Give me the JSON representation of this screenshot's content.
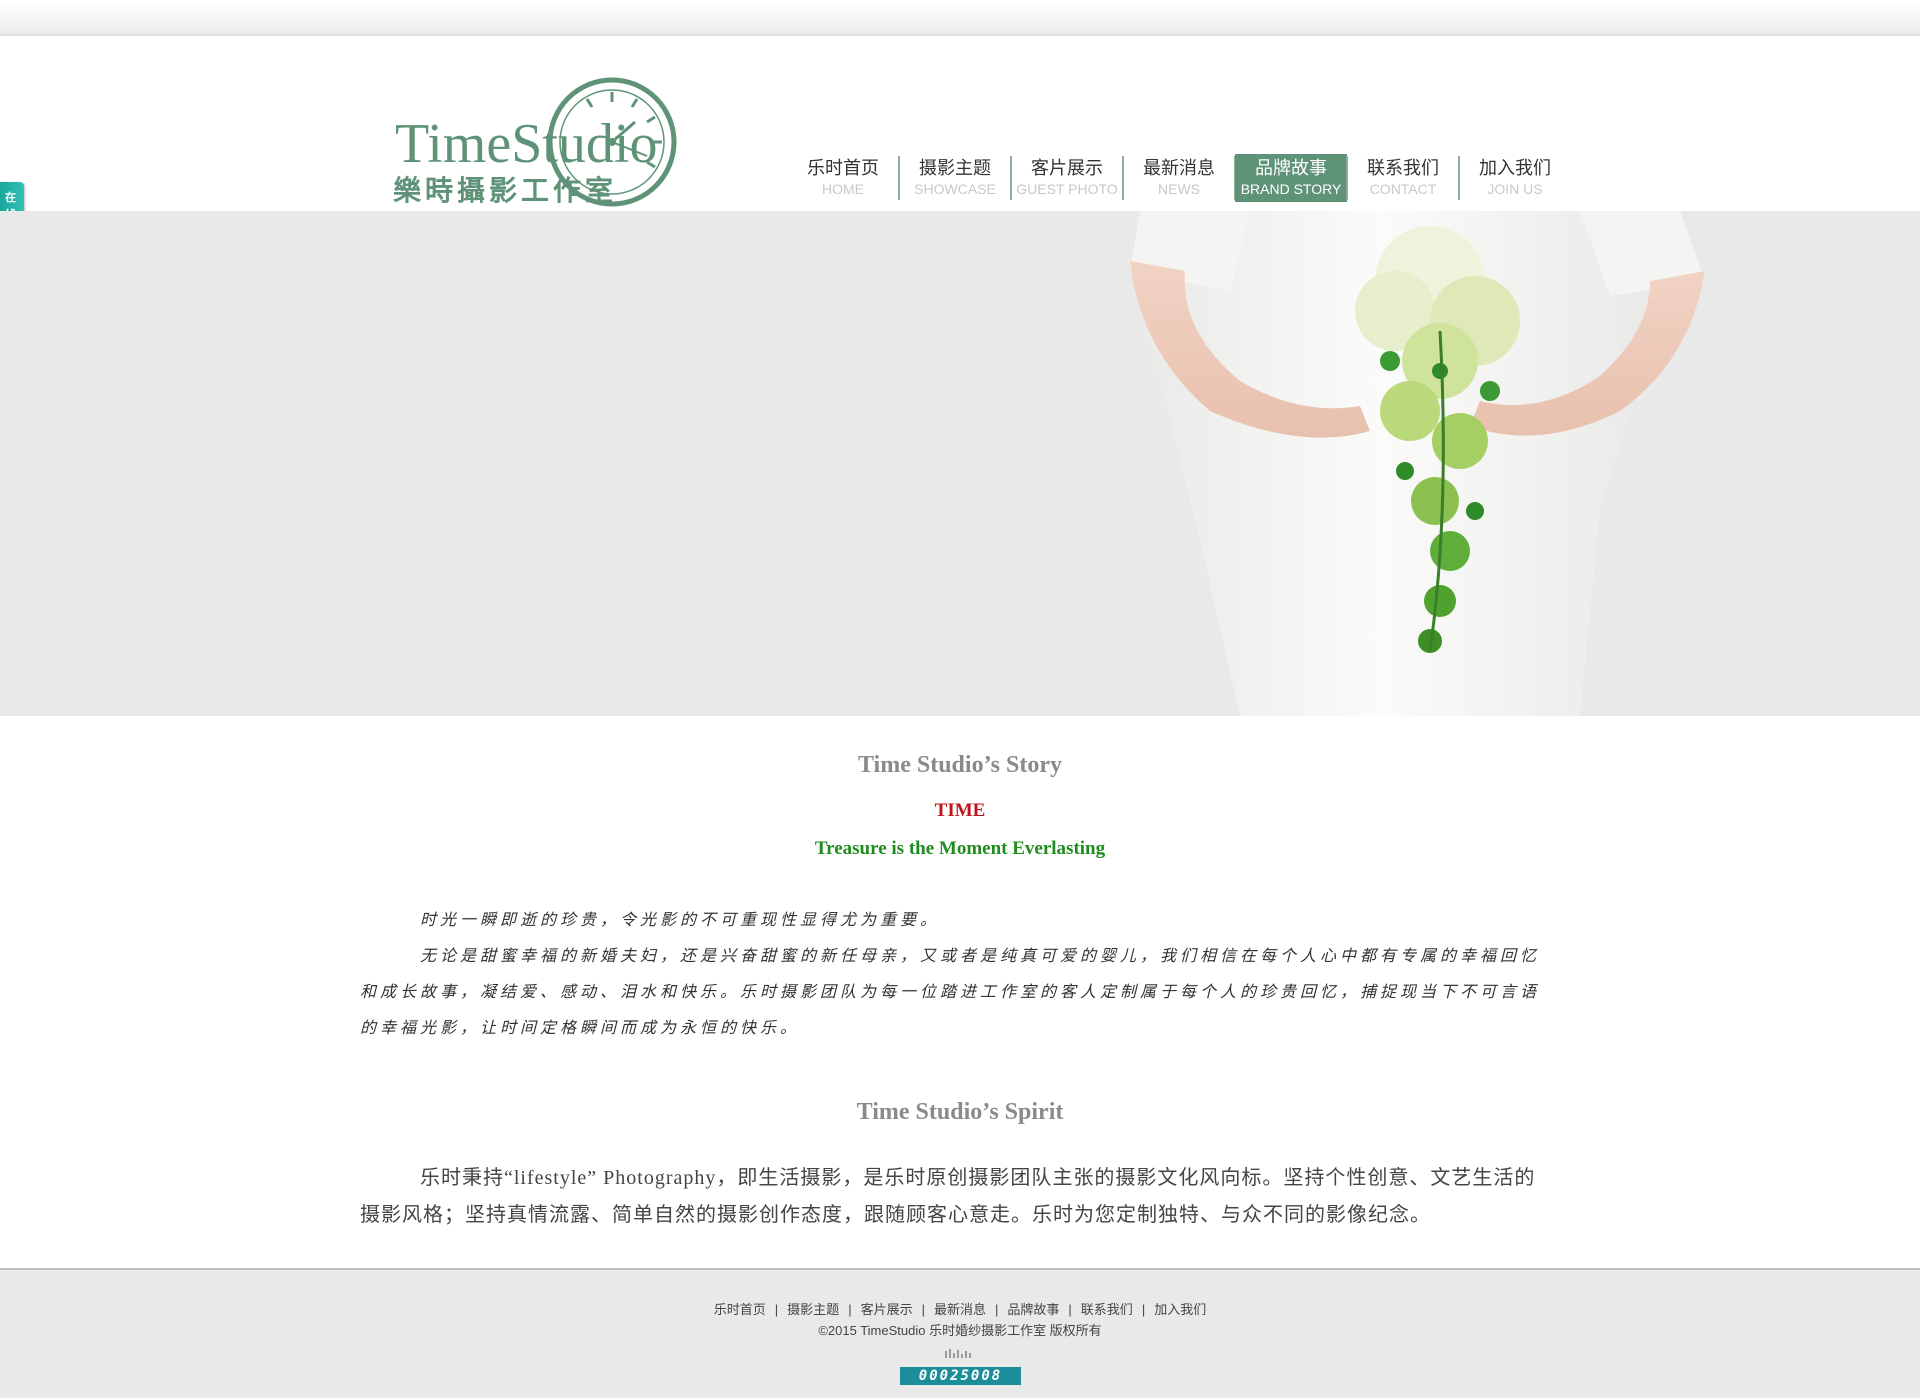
{
  "logo": {
    "name_en": "TimeStudio",
    "name_cn": "樂時攝影工作室"
  },
  "nav": {
    "items": [
      {
        "cn": "乐时首页",
        "en": "HOME"
      },
      {
        "cn": "摄影主题",
        "en": "SHOWCASE"
      },
      {
        "cn": "客片展示",
        "en": "GUEST PHOTO"
      },
      {
        "cn": "最新消息",
        "en": "NEWS"
      },
      {
        "cn": "品牌故事",
        "en": "BRAND STORY"
      },
      {
        "cn": "联系我们",
        "en": "CONTACT"
      },
      {
        "cn": "加入我们",
        "en": "JOIN US"
      }
    ],
    "active": "品牌故事"
  },
  "sidetab": {
    "label": "在线客服"
  },
  "content": {
    "story_title": "Time Studio’s Story",
    "time_label": "TIME",
    "tagline": "Treasure is the Moment Everlasting",
    "story_p1": "时光一瞬即逝的珍贵，令光影的不可重现性显得尤为重要。",
    "story_p2": "无论是甜蜜幸福的新婚夫妇，还是兴奋甜蜜的新任母亲，又或者是纯真可爱的婴儿，我们相信在每个人心中都有专属的幸福回忆和成长故事，凝结爱、感动、泪水和快乐。乐时摄影团队为每一位踏进工作室的客人定制属于每个人的珍贵回忆，捕捉现当下不可言语的幸福光影，让时间定格瞬间而成为永恒的快乐。",
    "spirit_title": "Time Studio’s Spirit",
    "spirit_text": "乐时秉持“lifestyle” Photography，即生活摄影，是乐时原创摄影团队主张的摄影文化风向标。坚持个性创意、文艺生活的摄影风格；坚持真情流露、简单自然的摄影创作态度，跟随顾客心意走。乐时为您定制独特、与众不同的影像纪念。"
  },
  "footer": {
    "links": [
      "乐时首页",
      "摄影主题",
      "客片展示",
      "最新消息",
      "品牌故事",
      "联系我们",
      "加入我们"
    ],
    "separator": "|",
    "copyright": "©2015 TimeStudio 乐时婚纱摄影工作室 版权所有",
    "counter": "00025008"
  },
  "colors": {
    "brand_green": "#5f9378",
    "nav_active_bg": "#5f9378",
    "time_red": "#c0141b",
    "tagline_green": "#1e8c1e",
    "sidetab_teal": "#1aa69b",
    "banner_bg": "#e9e9e9",
    "footer_bg": "#e9e9e9"
  }
}
